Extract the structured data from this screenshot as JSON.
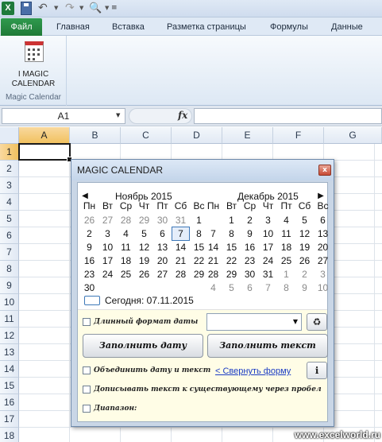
{
  "app": {
    "logo": "X"
  },
  "ribbon": {
    "tabs": [
      "Файл",
      "Главная",
      "Вставка",
      "Разметка страницы",
      "Формулы",
      "Данные"
    ],
    "calendar_button": "I MAGIC CALENDAR",
    "group_label": "Magic Calendar"
  },
  "formula_bar": {
    "name_box": "A1",
    "fx": "fx",
    "value": ""
  },
  "sheet": {
    "columns": [
      "A",
      "B",
      "C",
      "D",
      "E",
      "F",
      "G"
    ],
    "rows": [
      "1",
      "2",
      "3",
      "4",
      "5",
      "6",
      "7",
      "8",
      "9",
      "10",
      "11",
      "12",
      "13",
      "14",
      "15",
      "16",
      "17",
      "18"
    ],
    "active_cell": "A1"
  },
  "dialog": {
    "title": "MAGIC CALENDAR",
    "close": "x",
    "prev": "◀",
    "next": "▶",
    "weekdays": [
      "Пн",
      "Вт",
      "Ср",
      "Чт",
      "Пт",
      "Сб",
      "Вс"
    ],
    "months": [
      {
        "name": "Ноябрь 2015",
        "weeks": [
          [
            "26",
            "27",
            "28",
            "29",
            "30",
            "31",
            "1"
          ],
          [
            "2",
            "3",
            "4",
            "5",
            "6",
            "7",
            "8"
          ],
          [
            "9",
            "10",
            "11",
            "12",
            "13",
            "14",
            "15"
          ],
          [
            "16",
            "17",
            "18",
            "19",
            "20",
            "21",
            "22"
          ],
          [
            "23",
            "24",
            "25",
            "26",
            "27",
            "28",
            "29"
          ],
          [
            "30",
            "",
            "",
            "",
            "",
            "",
            ""
          ]
        ]
      },
      {
        "name": "Декабрь 2015",
        "weeks": [
          [
            "",
            "1",
            "2",
            "3",
            "4",
            "5",
            "6"
          ],
          [
            "7",
            "8",
            "9",
            "10",
            "11",
            "12",
            "13"
          ],
          [
            "14",
            "15",
            "16",
            "17",
            "18",
            "19",
            "20"
          ],
          [
            "21",
            "22",
            "23",
            "24",
            "25",
            "26",
            "27"
          ],
          [
            "28",
            "29",
            "30",
            "31",
            "1",
            "2",
            "3"
          ],
          [
            "4",
            "5",
            "6",
            "7",
            "8",
            "9",
            "10"
          ]
        ]
      }
    ],
    "selected_day": "7",
    "today_label": "Сегодня: 07.11.2015",
    "long_format_label": "Длинный формат даты",
    "format_combo_value": "",
    "fill_date_button": "Заполнить дату",
    "fill_text_button": "Заполнить текст",
    "combine_label": "Объединить дату и текст",
    "collapse_link": "< Свернуть форму",
    "append_label": "Дописывать текст к существующему через пробел",
    "range_label": "Диапазон:"
  },
  "watermark": "www.excelworld.ru"
}
